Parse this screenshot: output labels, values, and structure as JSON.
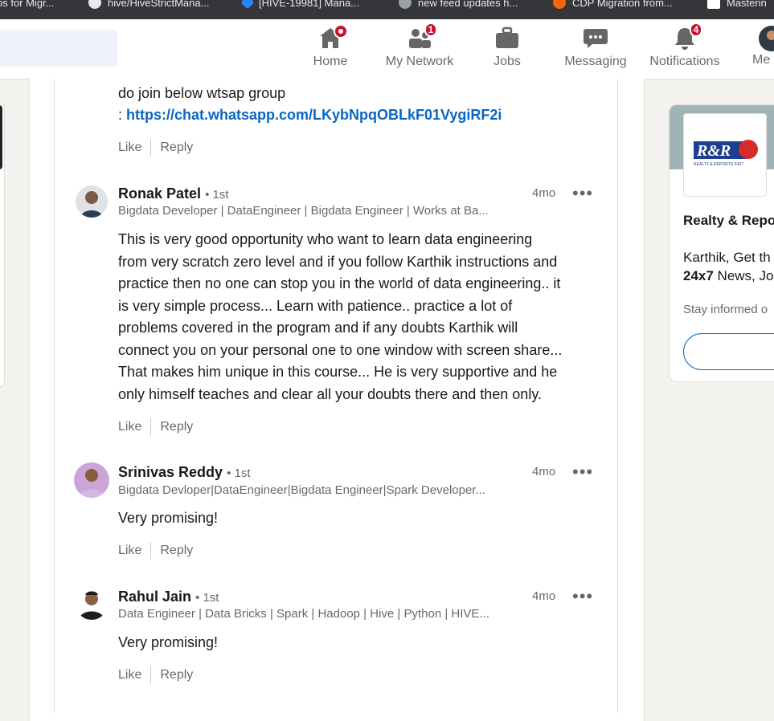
{
  "bookmarks": [
    {
      "label": "ps for Migr...",
      "icon": "bookmark-icon"
    },
    {
      "label": "hive/HiveStrictMana...",
      "icon": "github-icon"
    },
    {
      "label": "[HIVE-19981] Mana...",
      "icon": "jira-icon"
    },
    {
      "label": "new feed updates h...",
      "icon": "feed-icon"
    },
    {
      "label": "CDP Migration from...",
      "icon": "cloudera-icon"
    },
    {
      "label": "Masterin",
      "icon": "mk-icon"
    }
  ],
  "nav": {
    "home": "Home",
    "network": "My Network",
    "network_badge": "1",
    "jobs": "Jobs",
    "messaging": "Messaging",
    "notifications": "Notifications",
    "notifications_badge": "4",
    "me": "Me"
  },
  "top_comment": {
    "text": "do join below wtsap group",
    "link_prefix": ": ",
    "link": "https://chat.whatsapp.com/LKybNpqOBLkF01VygiRF2i",
    "like": "Like",
    "reply": "Reply"
  },
  "comments": [
    {
      "name": "Ronak Patel",
      "degree": "• 1st",
      "headline": "Bigdata Developer | DataEngineer | Bigdata Engineer | Works at Ba...",
      "time": "4mo",
      "lines": [
        "This is very good opportunity who want to learn data engineering",
        "from very scratch zero level and if you follow Karthik instructions and",
        "practice then no one can stop you in the world of data engineering.. it",
        "is very simple process... Learn with patience.. practice a lot of",
        "problems covered in the program and if any doubts Karthik will",
        "connect you on your personal one to one window with screen share...",
        "That makes him unique in this course... He is very supportive and he",
        "only himself teaches and clear all your doubts there and then only."
      ],
      "like": "Like",
      "reply": "Reply"
    },
    {
      "name": "Srinivas Reddy",
      "degree": "• 1st",
      "headline": "Bigdata Devloper|DataEngineer|Bigdata Engineer|Spark Developer...",
      "time": "4mo",
      "text": "Very promising!",
      "like": "Like",
      "reply": "Reply"
    },
    {
      "name": "Rahul Jain",
      "degree": "• 1st",
      "headline": "Data Engineer | Data Bricks | Spark | Hadoop | Hive | Python | HIVE...",
      "time": "4mo",
      "text": "Very promising!",
      "like": "Like",
      "reply": "Reply"
    }
  ],
  "ad": {
    "logo_text": "R&R",
    "logo_sub": "REALTY & REPORTS 24X7",
    "title": "Realty & Repo",
    "text_line1": "Karthik, Get th",
    "text_line2_bold": "24x7",
    "text_line2_rest": " News, Jo",
    "small": "Stay informed o"
  },
  "colors": {
    "link": "#0a66c2",
    "badge": "#cb112d",
    "nav_bg": "#ffffff",
    "bookmark_bar": "#35363a"
  }
}
